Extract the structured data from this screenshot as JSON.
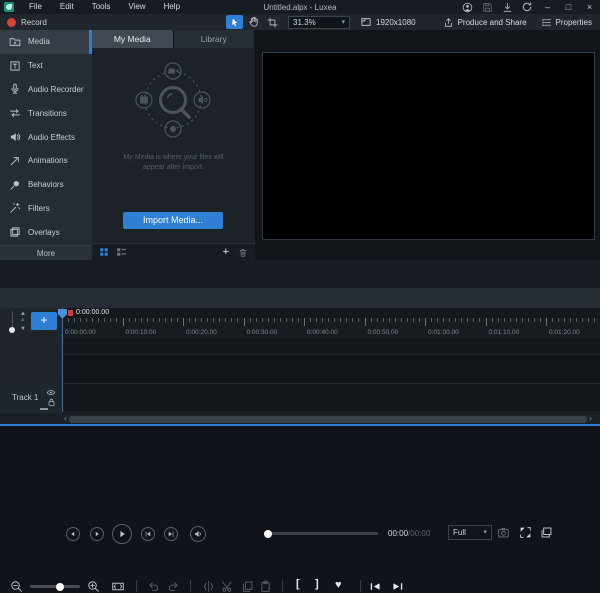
{
  "app": {
    "title": "Untitled.alpx - Luxea"
  },
  "menubar": {
    "items": [
      "File",
      "Edit",
      "Tools",
      "View",
      "Help"
    ]
  },
  "window_controls": {
    "minimize": "–",
    "maximize": "□",
    "close": "×"
  },
  "toolbar": {
    "record": "Record",
    "stage_zoom": "31.3%",
    "chevron": "▾",
    "canvas_size": "1920x1080",
    "produce": "Produce and Share",
    "properties": "Properties"
  },
  "sidebar": {
    "items": [
      {
        "label": "Media"
      },
      {
        "label": "Text"
      },
      {
        "label": "Audio Recorder"
      },
      {
        "label": "Transitions"
      },
      {
        "label": "Audio Effects"
      },
      {
        "label": "Animations"
      },
      {
        "label": "Behaviors"
      },
      {
        "label": "Filters"
      },
      {
        "label": "Overlays"
      }
    ],
    "more": "More"
  },
  "media_panel": {
    "tab_my_media": "My Media",
    "tab_library": "Library",
    "hint_line1": "My Media is where your files will",
    "hint_line2": "appear after import.",
    "import_button": "Import Media..."
  },
  "player": {
    "time_current": "00:00",
    "time_total": "/00:00",
    "view_mode": "Full",
    "chevron": "▾"
  },
  "tl_toolbar": {
    "bracket_in": "[",
    "bracket_out": "]",
    "marker": "♥"
  },
  "timeline": {
    "playhead_time": "0:00:00.00",
    "ruler_labels": [
      "0:00:00.00",
      "0:00:10.00",
      "0:00:20.00",
      "0:00:30.00",
      "0:00:40.00",
      "0:00:50.00",
      "0:01:00.00",
      "0:01:10.00",
      "0:01:20.00"
    ],
    "track_name": "Track 1",
    "scroll_left": "‹",
    "scroll_right": "›"
  },
  "colors": {
    "accent": "#2f80d4",
    "record_red": "#d9423a"
  }
}
